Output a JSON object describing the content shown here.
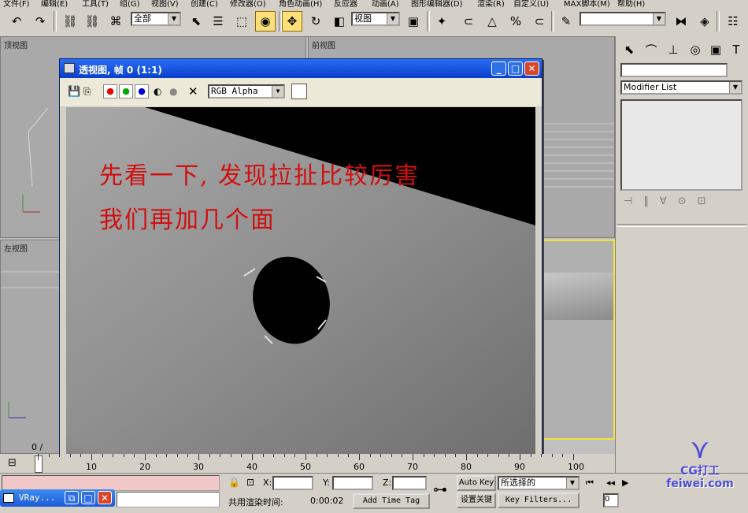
{
  "menubar": [
    "文件(F)",
    "编辑(E)",
    "工具(T)",
    "组(G)",
    "视图(V)",
    "创建(C)",
    "修改器(O)",
    "角色动画(H)",
    "反应器",
    "动画(A)",
    "图形编辑器(D)",
    "渲染(R)",
    "自定义(U)",
    "MAX脚本(M)",
    "帮助(H)"
  ],
  "toolbar": {
    "selection_filter": "全部",
    "ref_coord": "视图",
    "named_selection": ""
  },
  "viewports": {
    "top": "顶视图",
    "front": "前视图",
    "left": "左视图"
  },
  "command_panel": {
    "modifier_list": "Modifier List"
  },
  "render_window": {
    "title": "透视图, 帧 0 (1:1)",
    "channel": "RGB Alpha",
    "caption_line1": "先看一下, 发现拉扯比较厉害",
    "caption_line2": "我们再加几个面"
  },
  "timeline": {
    "frame": "0 /",
    "ticks": [
      "10",
      "20",
      "30",
      "40",
      "50",
      "60",
      "70",
      "80",
      "90",
      "100"
    ]
  },
  "status": {
    "x_label": "X:",
    "y_label": "Y:",
    "z_label": "Z:",
    "render_time_label": "共用渲染时间:",
    "render_time": "0:00:02",
    "add_time_tag": "Add Time Tag",
    "auto_key": "Auto Key",
    "set_key": "设置关键点",
    "selection": "所选择的",
    "key_filters": "Key Filters...",
    "frame_field": "0"
  },
  "taskbar": {
    "vray_label": "VRay..."
  },
  "watermark": "CG打工 feiwei.com"
}
